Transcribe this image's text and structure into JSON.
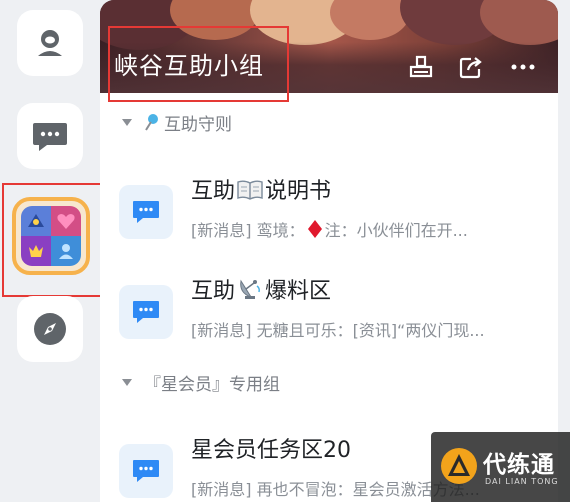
{
  "rail": {
    "items": [
      {
        "name": "profile-icon"
      },
      {
        "name": "chat-bubble-icon"
      },
      {
        "name": "group-avatar"
      },
      {
        "name": "compass-icon"
      }
    ]
  },
  "header": {
    "title": "峡谷互助小组",
    "actions": [
      "stamp-icon",
      "share-icon",
      "more-icon"
    ]
  },
  "sections": [
    {
      "label": "互助守则",
      "channels": [
        {
          "name_prefix": "互助",
          "name_emoji": "book",
          "name_suffix": "说明书",
          "msg_prefix": "[新消息] 鸾境：",
          "msg_emoji": "red-diamond",
          "msg_suffix": "注：小伙伴们在开..."
        },
        {
          "name_prefix": "互助",
          "name_emoji": "satellite",
          "name_suffix": "爆料区",
          "msg": "[新消息] 无糖且可乐：[资讯]“两仪门现..."
        }
      ]
    },
    {
      "label": "『星会员』专用组",
      "channels": [
        {
          "name": "星会员任务区20",
          "msg": "[新消息] 再也不冒泡：星会员激活方法..."
        }
      ]
    }
  ],
  "watermark": {
    "cn": "代练通",
    "en": "DAI LIAN TONG"
  },
  "colors": {
    "accent_blue": "#2f8af5",
    "highlight_red": "#e53935",
    "avatar_ring": "#f6b24c"
  }
}
